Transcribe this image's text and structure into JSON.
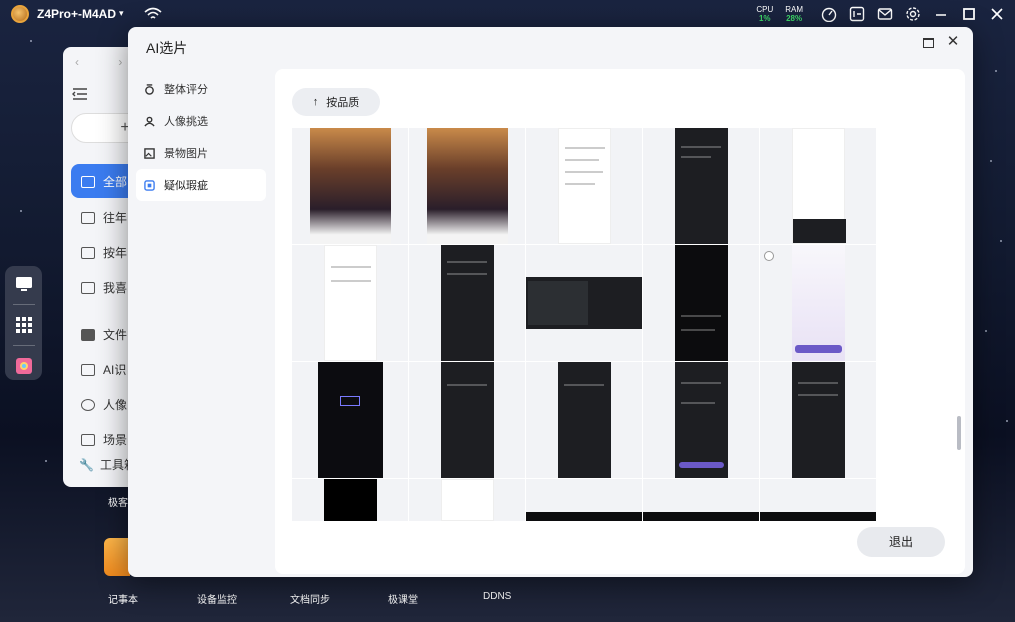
{
  "topbar": {
    "device_name": "Z4Pro+-M4AD",
    "cpu_label": "CPU",
    "cpu_value": "1%",
    "ram_label": "RAM",
    "ram_value": "28%"
  },
  "background_window": {
    "items": [
      {
        "label": "全部",
        "icon": "image-icon"
      },
      {
        "label": "往年",
        "icon": "image-icon"
      },
      {
        "label": "按年",
        "icon": "calendar-icon"
      },
      {
        "label": "我喜",
        "icon": "image-icon"
      },
      {
        "label": "文件",
        "icon": "folder-icon"
      },
      {
        "label": "AI识",
        "icon": "image-icon"
      },
      {
        "label": "人像",
        "icon": "face-icon"
      },
      {
        "label": "场景",
        "icon": "scene-icon"
      }
    ],
    "tools_label": "工具箱",
    "add_label": "+"
  },
  "desktop": {
    "mid_label": "极客",
    "apps": [
      "记事本",
      "设备监控",
      "文档同步",
      "极课堂",
      "DDNS"
    ]
  },
  "dialog": {
    "title": "AI选片",
    "sidebar": [
      {
        "label": "整体评分",
        "icon": "score-icon"
      },
      {
        "label": "人像挑选",
        "icon": "portrait-icon"
      },
      {
        "label": "景物图片",
        "icon": "landscape-icon"
      },
      {
        "label": "疑似瑕疵",
        "icon": "flaw-icon",
        "active": true
      }
    ],
    "sort_label": "按品质",
    "exit_label": "退出"
  },
  "colors": {
    "accent": "#3b7cf0",
    "green_stat": "#3fdc6a"
  }
}
